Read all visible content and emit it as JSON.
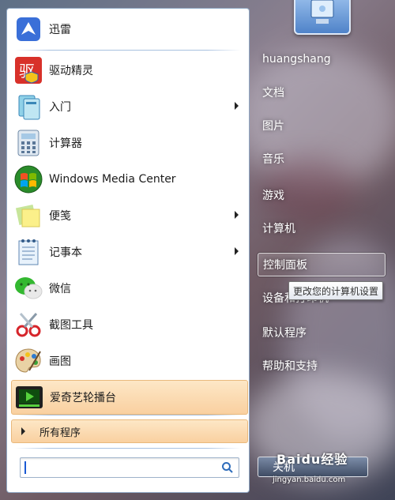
{
  "programs": [
    {
      "label": "迅雷",
      "icon": "xunlei-bird-icon",
      "has_submenu": false
    },
    {
      "label": "驱动精灵",
      "icon": "driver-genius-icon",
      "has_submenu": false
    },
    {
      "label": "入门",
      "icon": "getting-started-icon",
      "has_submenu": true
    },
    {
      "label": "计算器",
      "icon": "calculator-icon",
      "has_submenu": false
    },
    {
      "label": "Windows Media Center",
      "icon": "windows-logo-icon",
      "has_submenu": false
    },
    {
      "label": "便笺",
      "icon": "sticky-notes-icon",
      "has_submenu": true
    },
    {
      "label": "记事本",
      "icon": "notepad-icon",
      "has_submenu": true
    },
    {
      "label": "微信",
      "icon": "wechat-icon",
      "has_submenu": false
    },
    {
      "label": "截图工具",
      "icon": "scissors-icon",
      "has_submenu": false
    },
    {
      "label": "画图",
      "icon": "paint-palette-icon",
      "has_submenu": false
    },
    {
      "label": "爱奇艺轮播台",
      "icon": "iqiyi-tv-icon",
      "has_submenu": false
    }
  ],
  "all_programs_label": "所有程序",
  "search": {
    "placeholder": ""
  },
  "right_links": [
    {
      "label": "huangshang",
      "selected": false
    },
    {
      "label": "文档",
      "selected": false
    },
    {
      "label": "图片",
      "selected": false
    },
    {
      "label": "音乐",
      "selected": false
    },
    {
      "label": "游戏",
      "selected": false
    },
    {
      "label": "计算机",
      "selected": false
    },
    {
      "label": "控制面板",
      "selected": true
    },
    {
      "label": "设备和打印机",
      "selected": false
    },
    {
      "label": "默认程序",
      "selected": false
    },
    {
      "label": "帮助和支持",
      "selected": false
    }
  ],
  "tooltip": "更改您的计算机设置",
  "shutdown_label": "关机",
  "watermark": {
    "logo": "Baidu经验",
    "url": "jingyan.baidu.com"
  },
  "colors": {
    "highlight": "#f9d0a0",
    "panel": "#ffffff",
    "accent": "#1a5ad4"
  }
}
